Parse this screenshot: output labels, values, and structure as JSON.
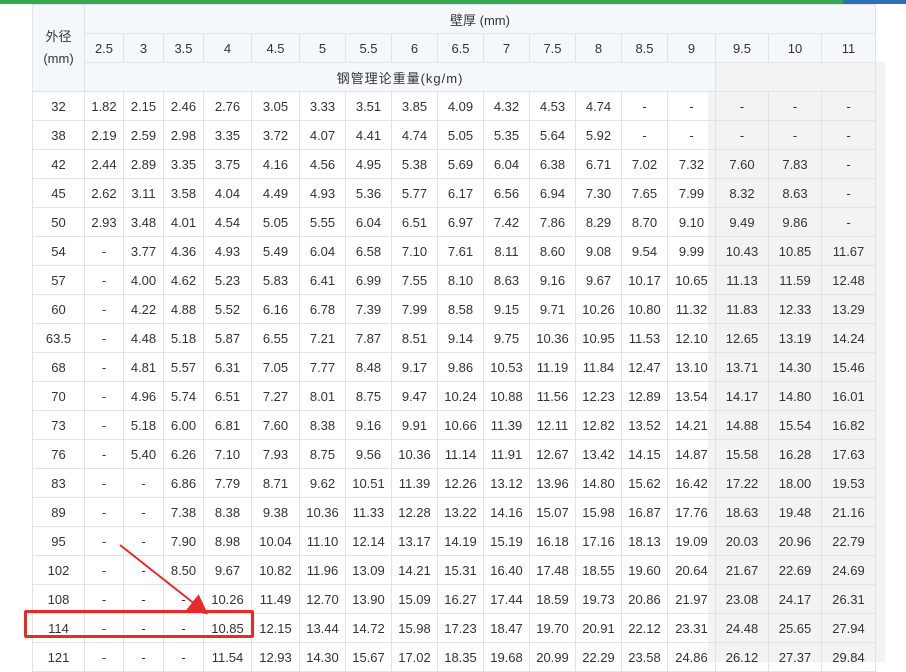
{
  "header": {
    "od_label_line1": "外径",
    "od_label_line2": "(mm)",
    "wall_label": "壁厚 (mm)",
    "unit_label": "钢管理论重量(kg/m)",
    "thickness": [
      "2.5",
      "3",
      "3.5",
      "4",
      "4.5",
      "5",
      "5.5",
      "6",
      "6.5",
      "7",
      "7.5",
      "8",
      "8.5",
      "9",
      "9.5",
      "10",
      "11"
    ]
  },
  "rows": [
    {
      "od": "32",
      "values": [
        "1.82",
        "2.15",
        "2.46",
        "2.76",
        "3.05",
        "3.33",
        "3.51",
        "3.85",
        "4.09",
        "4.32",
        "4.53",
        "4.74",
        "-",
        "-",
        "-",
        "-",
        "-"
      ]
    },
    {
      "od": "38",
      "values": [
        "2.19",
        "2.59",
        "2.98",
        "3.35",
        "3.72",
        "4.07",
        "4.41",
        "4.74",
        "5.05",
        "5.35",
        "5.64",
        "5.92",
        "-",
        "-",
        "-",
        "-",
        "-"
      ]
    },
    {
      "od": "42",
      "values": [
        "2.44",
        "2.89",
        "3.35",
        "3.75",
        "4.16",
        "4.56",
        "4.95",
        "5.38",
        "5.69",
        "6.04",
        "6.38",
        "6.71",
        "7.02",
        "7.32",
        "7.60",
        "7.83",
        "-"
      ]
    },
    {
      "od": "45",
      "values": [
        "2.62",
        "3.11",
        "3.58",
        "4.04",
        "4.49",
        "4.93",
        "5.36",
        "5.77",
        "6.17",
        "6.56",
        "6.94",
        "7.30",
        "7.65",
        "7.99",
        "8.32",
        "8.63",
        "-"
      ]
    },
    {
      "od": "50",
      "values": [
        "2.93",
        "3.48",
        "4.01",
        "4.54",
        "5.05",
        "5.55",
        "6.04",
        "6.51",
        "6.97",
        "7.42",
        "7.86",
        "8.29",
        "8.70",
        "9.10",
        "9.49",
        "9.86",
        "-"
      ]
    },
    {
      "od": "54",
      "values": [
        "-",
        "3.77",
        "4.36",
        "4.93",
        "5.49",
        "6.04",
        "6.58",
        "7.10",
        "7.61",
        "8.11",
        "8.60",
        "9.08",
        "9.54",
        "9.99",
        "10.43",
        "10.85",
        "11.67"
      ]
    },
    {
      "od": "57",
      "values": [
        "-",
        "4.00",
        "4.62",
        "5.23",
        "5.83",
        "6.41",
        "6.99",
        "7.55",
        "8.10",
        "8.63",
        "9.16",
        "9.67",
        "10.17",
        "10.65",
        "11.13",
        "11.59",
        "12.48"
      ]
    },
    {
      "od": "60",
      "values": [
        "-",
        "4.22",
        "4.88",
        "5.52",
        "6.16",
        "6.78",
        "7.39",
        "7.99",
        "8.58",
        "9.15",
        "9.71",
        "10.26",
        "10.80",
        "11.32",
        "11.83",
        "12.33",
        "13.29"
      ]
    },
    {
      "od": "63.5",
      "values": [
        "-",
        "4.48",
        "5.18",
        "5.87",
        "6.55",
        "7.21",
        "7.87",
        "8.51",
        "9.14",
        "9.75",
        "10.36",
        "10.95",
        "11.53",
        "12.10",
        "12.65",
        "13.19",
        "14.24"
      ]
    },
    {
      "od": "68",
      "values": [
        "-",
        "4.81",
        "5.57",
        "6.31",
        "7.05",
        "7.77",
        "8.48",
        "9.17",
        "9.86",
        "10.53",
        "11.19",
        "11.84",
        "12.47",
        "13.10",
        "13.71",
        "14.30",
        "15.46"
      ]
    },
    {
      "od": "70",
      "values": [
        "-",
        "4.96",
        "5.74",
        "6.51",
        "7.27",
        "8.01",
        "8.75",
        "9.47",
        "10.24",
        "10.88",
        "11.56",
        "12.23",
        "12.89",
        "13.54",
        "14.17",
        "14.80",
        "16.01"
      ]
    },
    {
      "od": "73",
      "values": [
        "-",
        "5.18",
        "6.00",
        "6.81",
        "7.60",
        "8.38",
        "9.16",
        "9.91",
        "10.66",
        "11.39",
        "12.11",
        "12.82",
        "13.52",
        "14.21",
        "14.88",
        "15.54",
        "16.82"
      ]
    },
    {
      "od": "76",
      "values": [
        "-",
        "5.40",
        "6.26",
        "7.10",
        "7.93",
        "8.75",
        "9.56",
        "10.36",
        "11.14",
        "11.91",
        "12.67",
        "13.42",
        "14.15",
        "14.87",
        "15.58",
        "16.28",
        "17.63"
      ]
    },
    {
      "od": "83",
      "values": [
        "-",
        "-",
        "6.86",
        "7.79",
        "8.71",
        "9.62",
        "10.51",
        "11.39",
        "12.26",
        "13.12",
        "13.96",
        "14.80",
        "15.62",
        "16.42",
        "17.22",
        "18.00",
        "19.53"
      ]
    },
    {
      "od": "89",
      "values": [
        "-",
        "-",
        "7.38",
        "8.38",
        "9.38",
        "10.36",
        "11.33",
        "12.28",
        "13.22",
        "14.16",
        "15.07",
        "15.98",
        "16.87",
        "17.76",
        "18.63",
        "19.48",
        "21.16"
      ]
    },
    {
      "od": "95",
      "values": [
        "-",
        "-",
        "7.90",
        "8.98",
        "10.04",
        "11.10",
        "12.14",
        "13.17",
        "14.19",
        "15.19",
        "16.18",
        "17.16",
        "18.13",
        "19.09",
        "20.03",
        "20.96",
        "22.79"
      ]
    },
    {
      "od": "102",
      "values": [
        "-",
        "-",
        "8.50",
        "9.67",
        "10.82",
        "11.96",
        "13.09",
        "14.21",
        "15.31",
        "16.40",
        "17.48",
        "18.55",
        "19.60",
        "20.64",
        "21.67",
        "22.69",
        "24.69"
      ]
    },
    {
      "od": "108",
      "values": [
        "-",
        "-",
        "-",
        "10.26",
        "11.49",
        "12.70",
        "13.90",
        "15.09",
        "16.27",
        "17.44",
        "18.59",
        "19.73",
        "20.86",
        "21.97",
        "23.08",
        "24.17",
        "26.31"
      ]
    },
    {
      "od": "114",
      "values": [
        "-",
        "-",
        "-",
        "10.85",
        "12.15",
        "13.44",
        "14.72",
        "15.98",
        "17.23",
        "18.47",
        "19.70",
        "20.91",
        "22.12",
        "23.31",
        "24.48",
        "25.65",
        "27.94"
      ]
    },
    {
      "od": "121",
      "values": [
        "-",
        "-",
        "-",
        "11.54",
        "12.93",
        "14.30",
        "15.67",
        "17.02",
        "18.35",
        "19.68",
        "20.99",
        "22.29",
        "23.58",
        "24.86",
        "26.12",
        "27.37",
        "29.84"
      ]
    }
  ],
  "annotation": {
    "highlight_color": "#e82a2a"
  }
}
